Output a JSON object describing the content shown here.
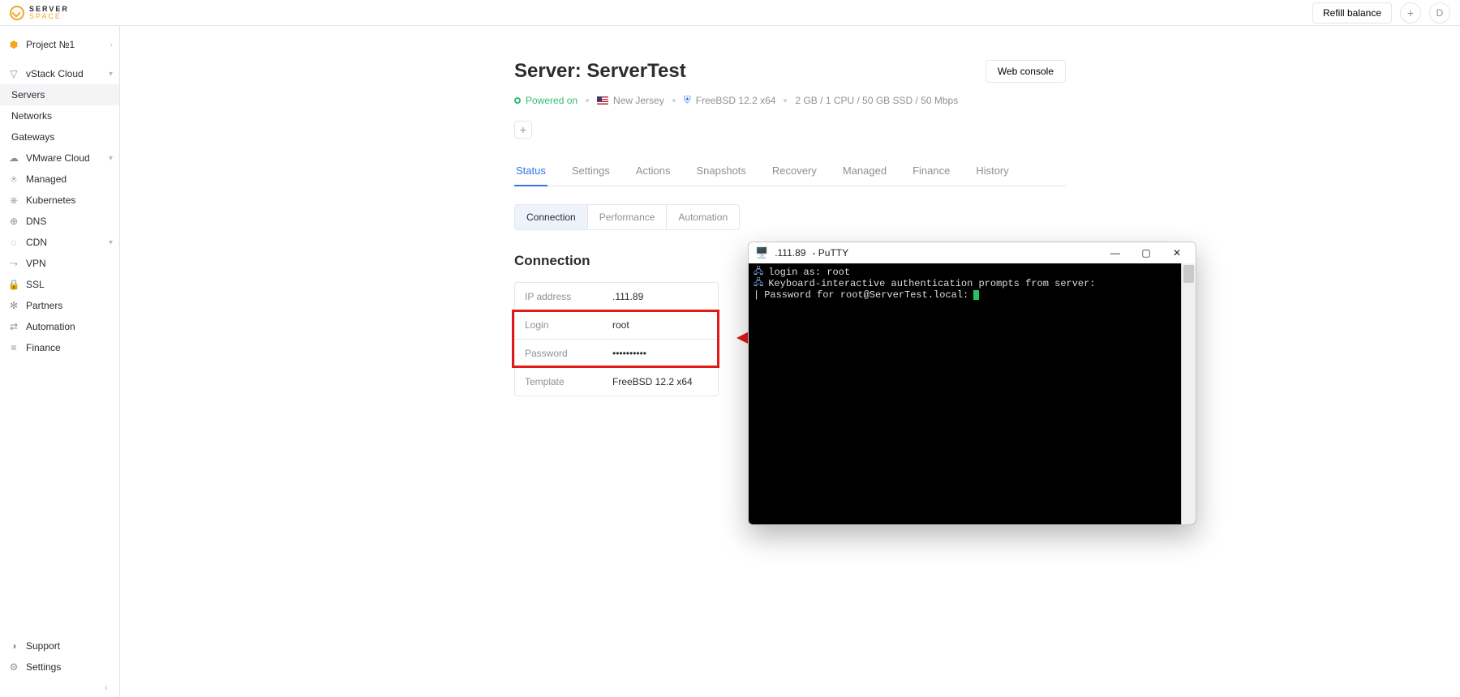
{
  "brand": {
    "line1": "SERVER",
    "line2": "SPACE"
  },
  "topbar": {
    "refill_label": "Refill balance",
    "plus_label": "+",
    "avatar_initial": "D"
  },
  "sidebar": {
    "project": "Project №1",
    "vstack": "vStack Cloud",
    "servers": "Servers",
    "networks": "Networks",
    "gateways": "Gateways",
    "vmware": "VMware Cloud",
    "managed": "Managed",
    "kubernetes": "Kubernetes",
    "dns": "DNS",
    "cdn": "CDN",
    "vpn": "VPN",
    "ssl": "SSL",
    "partners": "Partners",
    "automation": "Automation",
    "finance": "Finance",
    "support": "Support",
    "settings": "Settings"
  },
  "page": {
    "title": "Server: ServerTest",
    "web_console": "Web console",
    "power_state": "Powered on",
    "location": "New Jersey",
    "os": "FreeBSD 12.2 x64",
    "specs": "2 GB / 1 CPU / 50 GB SSD / 50 Mbps"
  },
  "tabs": {
    "status": "Status",
    "settings": "Settings",
    "actions": "Actions",
    "snapshots": "Snapshots",
    "recovery": "Recovery",
    "managed": "Managed",
    "finance": "Finance",
    "history": "History"
  },
  "subtabs": {
    "connection": "Connection",
    "performance": "Performance",
    "automation": "Automation"
  },
  "section_title": "Connection",
  "conn": {
    "ip_label": "IP address",
    "ip_value": ".111.89",
    "login_label": "Login",
    "login_value": "root",
    "password_label": "Password",
    "password_value": "••••••••••",
    "template_label": "Template",
    "template_value": "FreeBSD 12.2 x64"
  },
  "putty": {
    "title_ip": ".111.89",
    "title_app": " - PuTTY",
    "line1": "login as: root",
    "line2": "Keyboard-interactive authentication prompts from server:",
    "line3_prefix": "| ",
    "line3": "Password for root@ServerTest.local:"
  }
}
